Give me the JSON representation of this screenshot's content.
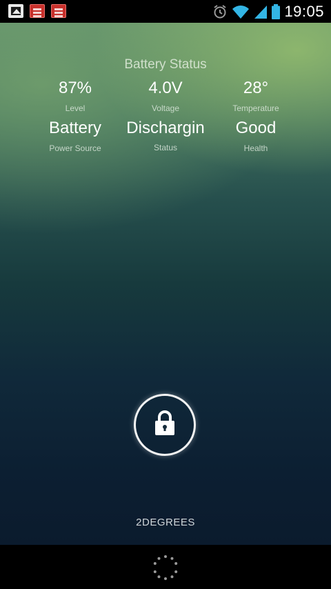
{
  "status_bar": {
    "notification_icons": [
      "gallery-icon",
      "app-notification-icon",
      "app-notification-icon"
    ],
    "system_icons": [
      "alarm-icon",
      "wifi-icon",
      "cell-signal-icon",
      "battery-icon"
    ],
    "time": "19:05"
  },
  "battery_widget": {
    "title": "Battery Status",
    "items": [
      {
        "value": "87%",
        "label": "Level"
      },
      {
        "value": "4.0V",
        "label": "Voltage"
      },
      {
        "value": "28°",
        "label": "Temperature"
      },
      {
        "value": "Battery",
        "label": "Power Source"
      },
      {
        "value": "Dischargin",
        "label": "Status"
      },
      {
        "value": "Good",
        "label": "Health"
      }
    ]
  },
  "lockscreen": {
    "unlock_icon": "lock-icon",
    "carrier": "2DEGREES"
  },
  "nav": {
    "icon": "loading-dots-icon"
  },
  "colors": {
    "status_bar_bg": "#000000",
    "accent_blue": "#33b5e5",
    "text_primary": "#ffffff"
  }
}
